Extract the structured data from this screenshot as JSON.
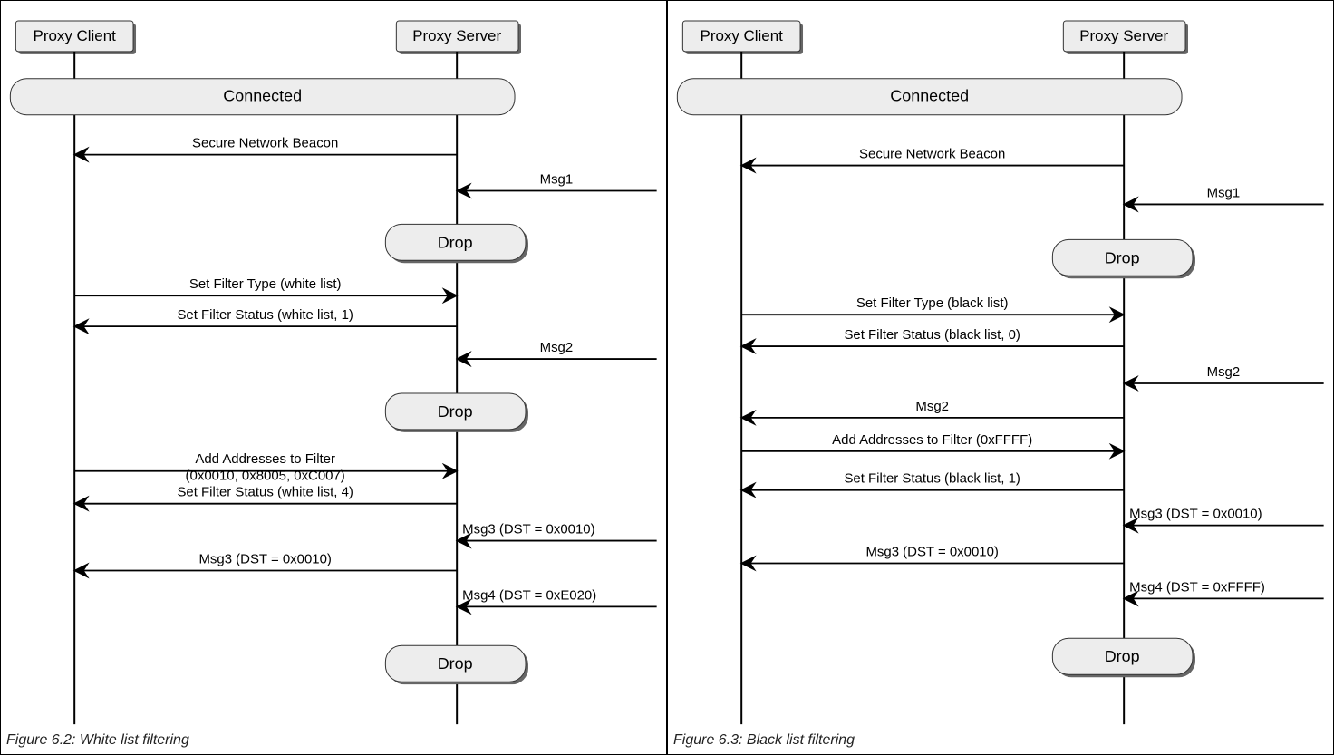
{
  "left": {
    "caption": "Figure 6.2: White list filtering",
    "client": "Proxy Client",
    "server": "Proxy Server",
    "state": "Connected",
    "drop": "Drop",
    "messages": {
      "beacon": "Secure Network Beacon",
      "msg1": "Msg1",
      "setFilterType": "Set Filter Type (white list)",
      "setFilterStatus1": "Set Filter Status (white list, 1)",
      "msg2": "Msg2",
      "addAddr1": "Add Addresses to Filter",
      "addAddr2": "(0x0010, 0x8005, 0xC007)",
      "setFilterStatus4": "Set Filter Status (white list, 4)",
      "msg3ext": "Msg3 (DST = 0x0010)",
      "msg3int": "Msg3 (DST = 0x0010)",
      "msg4ext": "Msg4 (DST = 0xE020)"
    }
  },
  "right": {
    "caption": "Figure 6.3: Black list filtering",
    "client": "Proxy Client",
    "server": "Proxy Server",
    "state": "Connected",
    "drop": "Drop",
    "messages": {
      "beacon": "Secure Network Beacon",
      "msg1": "Msg1",
      "setFilterType": "Set Filter Type (black list)",
      "setFilterStatus0": "Set Filter Status (black list, 0)",
      "msg2ext": "Msg2",
      "msg2int": "Msg2",
      "addAddr": "Add Addresses to Filter (0xFFFF)",
      "setFilterStatus1": "Set Filter Status (black list, 1)",
      "msg3ext": "Msg3 (DST = 0x0010)",
      "msg3int": "Msg3 (DST = 0x0010)",
      "msg4ext": "Msg4 (DST = 0xFFFF)"
    }
  }
}
